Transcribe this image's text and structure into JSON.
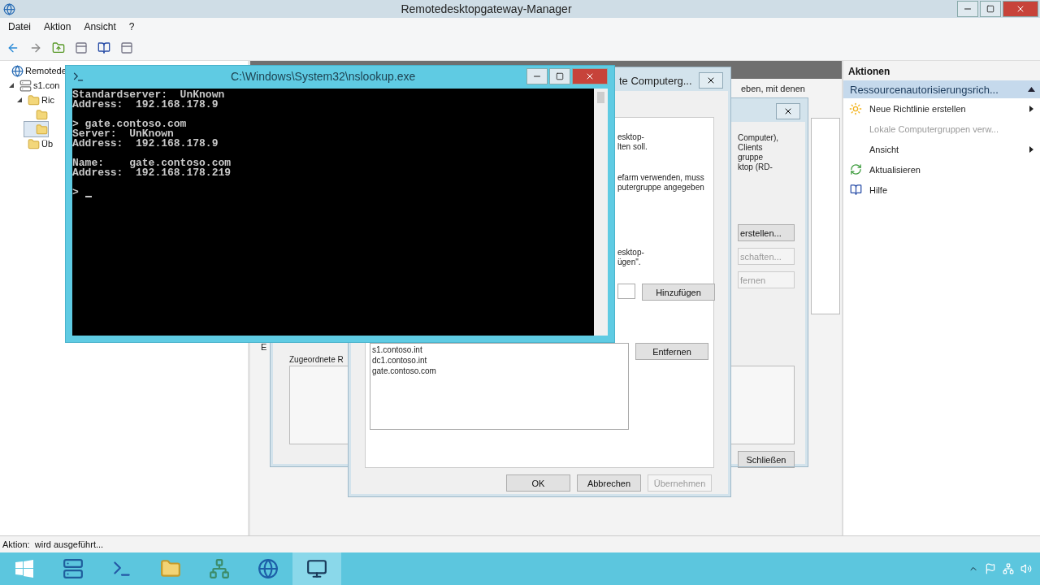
{
  "window": {
    "title": "Remotedesktopgateway-Manager"
  },
  "menu": [
    "Datei",
    "Aktion",
    "Ansicht",
    "?"
  ],
  "tree": [
    {
      "label": "Remotede",
      "kind": "root",
      "selected": false,
      "children": [
        {
          "label": "s1.con",
          "kind": "server",
          "expanded": true,
          "selected": false,
          "children": [
            {
              "label": "Ric",
              "kind": "folder",
              "expanded": true,
              "selected": false,
              "children": [
                {
                  "kind": "folder",
                  "selected": false
                },
                {
                  "kind": "folder",
                  "selected": true
                }
              ]
            },
            {
              "label": "Üb",
              "kind": "folder",
              "selected": false
            }
          ]
        }
      ]
    }
  ],
  "center_pane": {
    "text": "eben, mit denen",
    "label": "E"
  },
  "dialog_a": {
    "info": [
      "Computer),",
      "Clients",
      "gruppe",
      "ktop (RD-"
    ],
    "buttons": [
      {
        "label": "erstellen...",
        "disabled": false
      },
      {
        "label": "schaften...",
        "disabled": true
      },
      {
        "label": "fernen",
        "disabled": true
      }
    ],
    "list_label": "Zugeordnete R",
    "close_button": "Schließen"
  },
  "dialog_b": {
    "title": "te Computerg...",
    "paragraphs": [
      [
        "esktop-",
        "lten soll."
      ],
      [
        "efarm verwenden, muss",
        "putergruppe angegeben"
      ],
      [
        "esktop-",
        "ügen\"."
      ]
    ],
    "add_button": "Hinzufügen",
    "list": [
      "s1.contoso.int",
      "dc1.contoso.int",
      "gate.contoso.com"
    ],
    "remove_button": "Entfernen",
    "buttons": [
      {
        "label": "OK",
        "disabled": false
      },
      {
        "label": "Abbrechen",
        "disabled": false
      },
      {
        "label": "Übernehmen",
        "disabled": true
      }
    ]
  },
  "console": {
    "title": "C:\\Windows\\System32\\nslookup.exe",
    "blocks": [
      [
        "Standardserver:  UnKnown",
        "Address:  192.168.178.9"
      ],
      [
        "> gate.contoso.com",
        "Server:  UnKnown",
        "Address:  192.168.178.9"
      ],
      [
        "Name:    gate.contoso.com",
        "Address:  192.168.178.219"
      ]
    ],
    "prompt": ">"
  },
  "actions": {
    "title": "Aktionen",
    "section": "Ressourcenautorisierungsrich...",
    "items": [
      {
        "label": "Neue Richtlinie erstellen",
        "submenu": true,
        "disabled": false
      },
      {
        "label": "Lokale Computergruppen verw...",
        "submenu": false,
        "disabled": true
      },
      {
        "label": "Ansicht",
        "submenu": true,
        "disabled": false
      },
      {
        "label": "Aktualisieren",
        "submenu": false,
        "disabled": false
      },
      {
        "label": "Hilfe",
        "submenu": false,
        "disabled": false
      }
    ]
  },
  "status_bar": "Aktion:  wird ausgeführt...",
  "taskbar": {
    "apps": [
      {
        "selected": false
      },
      {
        "selected": false
      },
      {
        "selected": false
      },
      {
        "selected": false
      },
      {
        "selected": false
      },
      {
        "selected": true
      }
    ]
  }
}
